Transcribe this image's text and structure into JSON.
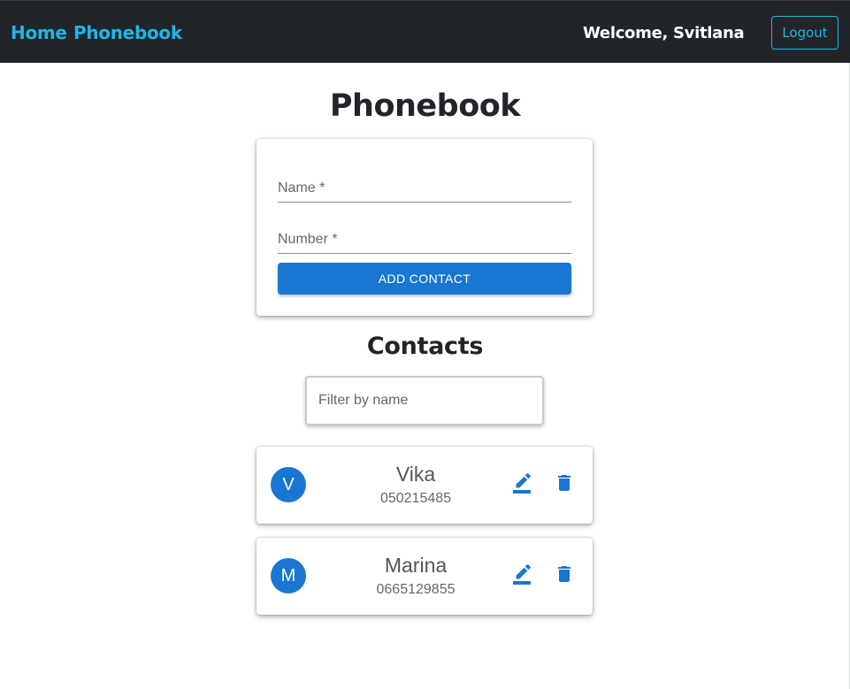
{
  "navbar": {
    "home_label": "Home",
    "phonebook_label": "Phonebook",
    "welcome_text": "Welcome, Svitlana",
    "logout_label": "Logout"
  },
  "page_title": "Phonebook",
  "form": {
    "name_label": "Name *",
    "name_value": "",
    "number_label": "Number *",
    "number_value": "",
    "submit_label": "ADD CONTACT"
  },
  "contacts_title": "Contacts",
  "filter": {
    "placeholder": "Filter by name",
    "value": ""
  },
  "contacts": [
    {
      "initial": "V",
      "name": "Vika",
      "number": "050215485",
      "edit_icon": "pencil-icon",
      "delete_icon": "trash-icon"
    },
    {
      "initial": "M",
      "name": "Marina",
      "number": "0665129855",
      "edit_icon": "pencil-icon",
      "delete_icon": "trash-icon"
    }
  ],
  "colors": {
    "navbar_bg": "#212529",
    "nav_link": "#1fb6e8",
    "primary": "#1976d2",
    "text_dark": "#212529"
  }
}
